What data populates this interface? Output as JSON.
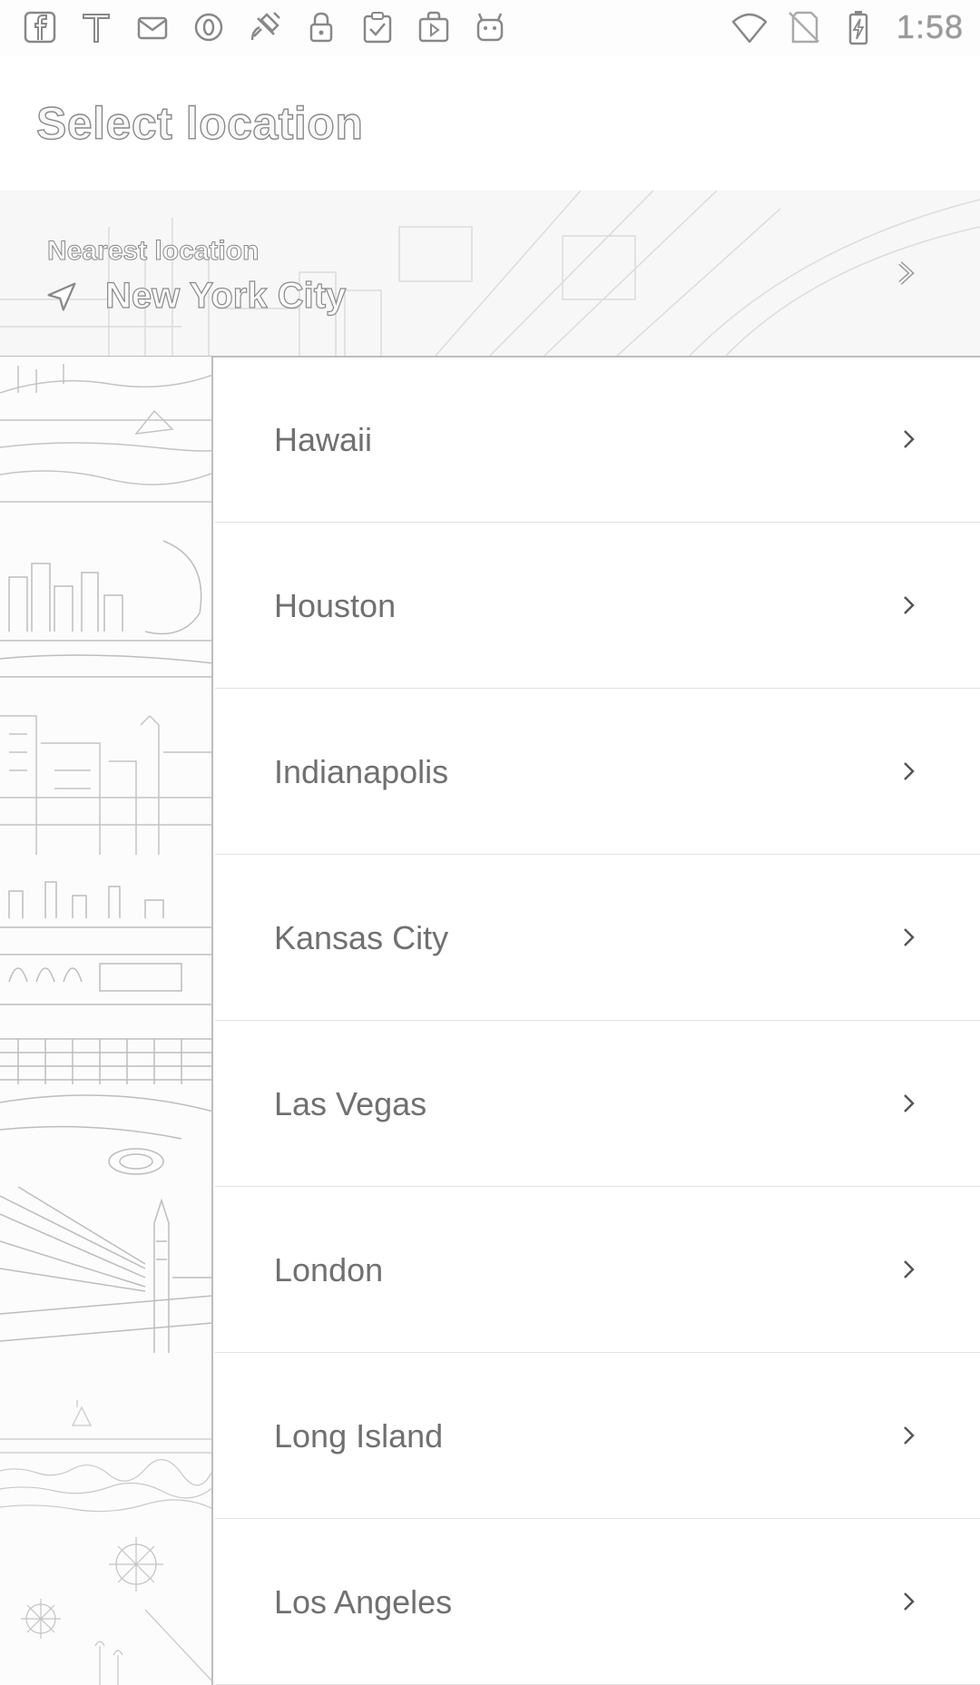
{
  "status_bar": {
    "left_icons": [
      "facebook-icon",
      "text-t-icon",
      "mail-icon",
      "circle-o-icon",
      "satellite-icon",
      "lock-icon",
      "clipboard-check-icon",
      "play-bag-icon",
      "android-icon"
    ],
    "right_icons": [
      "wifi-icon",
      "no-sim-icon",
      "battery-charging-icon"
    ],
    "time": "1:58"
  },
  "app_bar": {
    "title": "Select location"
  },
  "nearest": {
    "label": "Nearest location",
    "city": "New York City"
  },
  "locations": [
    {
      "name": "Hawaii"
    },
    {
      "name": "Houston"
    },
    {
      "name": "Indianapolis"
    },
    {
      "name": "Kansas City"
    },
    {
      "name": "Las Vegas"
    },
    {
      "name": "London"
    },
    {
      "name": "Long Island"
    },
    {
      "name": "Los Angeles"
    }
  ],
  "colors": {
    "background": "#ffffff",
    "text": "#707070",
    "divider": "#e4e4e4"
  }
}
